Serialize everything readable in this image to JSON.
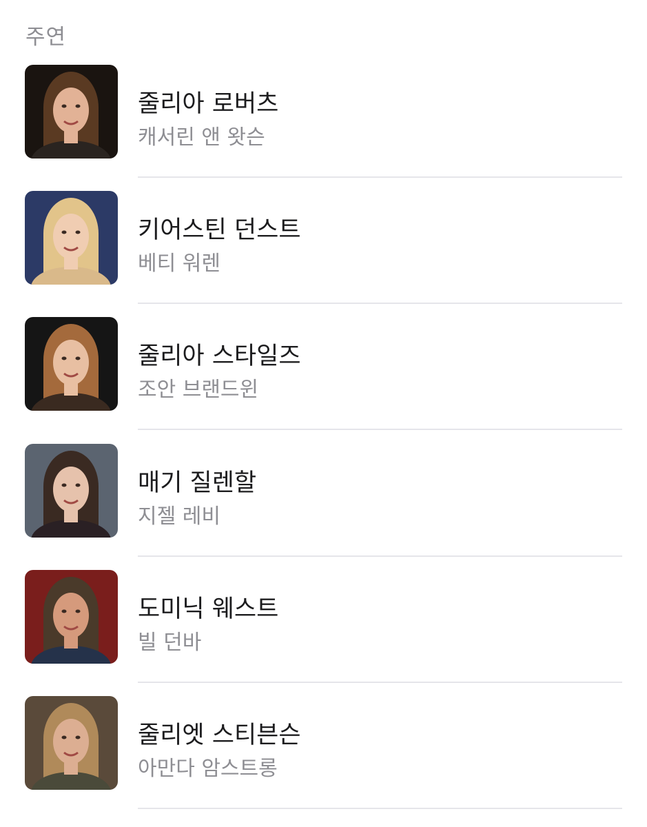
{
  "section": {
    "title": "주연"
  },
  "cast": [
    {
      "name": "줄리아 로버츠",
      "role": "캐서린 앤 왓슨",
      "bg": "#1a1410",
      "hair": "#5a3a22",
      "skin": "#e2b296",
      "cloth": "#2a2420"
    },
    {
      "name": "키어스틴 던스트",
      "role": "베티 워렌",
      "bg": "#2c3a66",
      "hair": "#e2c48a",
      "skin": "#f0cdb2",
      "cloth": "#d9b98a"
    },
    {
      "name": "줄리아 스타일즈",
      "role": "조안 브랜드윈",
      "bg": "#151515",
      "hair": "#a46a3c",
      "skin": "#e8bfa2",
      "cloth": "#3a2a20"
    },
    {
      "name": "매기 질렌할",
      "role": "지젤 레비",
      "bg": "#5b6470",
      "hair": "#3a2a22",
      "skin": "#e6c2ac",
      "cloth": "#2a2024"
    },
    {
      "name": "도미닉 웨스트",
      "role": "빌 던바",
      "bg": "#7a1e1c",
      "hair": "#4a3a2a",
      "skin": "#d59a7c",
      "cloth": "#25324a"
    },
    {
      "name": "줄리엣 스티븐슨",
      "role": "아만다 암스트롱",
      "bg": "#5a4a3a",
      "hair": "#b08a5a",
      "skin": "#dcae92",
      "cloth": "#4a4a3a"
    }
  ]
}
